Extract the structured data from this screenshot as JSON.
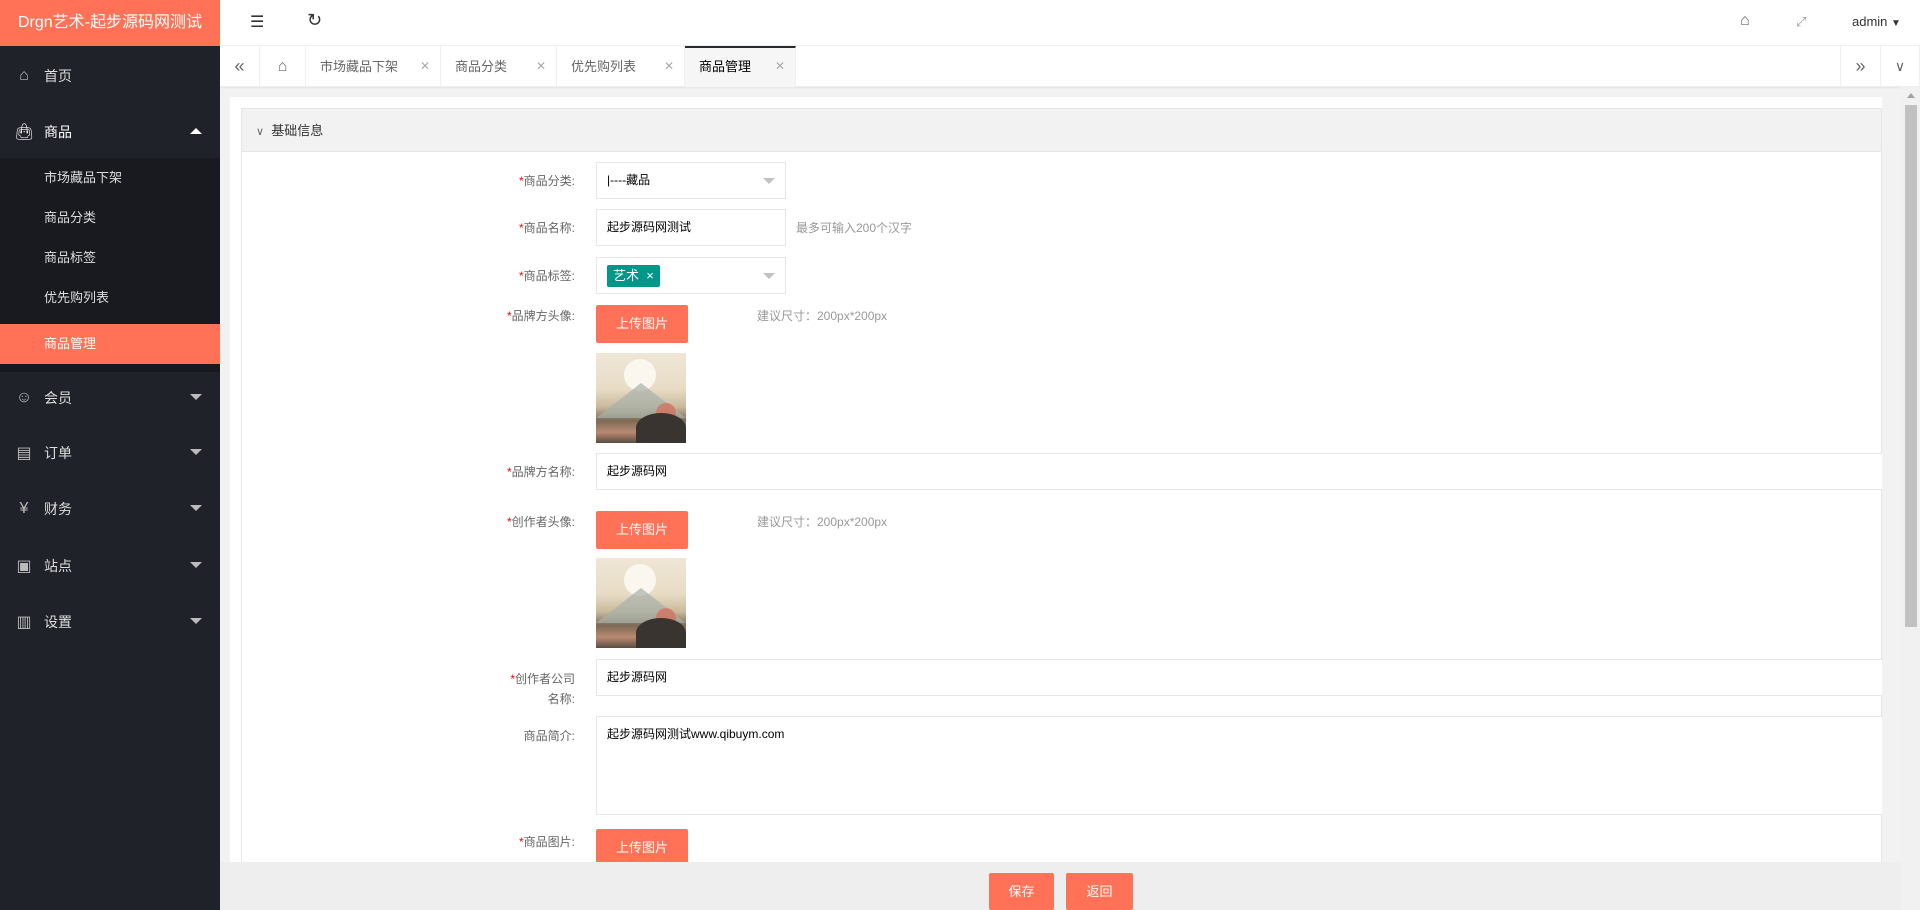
{
  "app": {
    "title": "Drgn艺术-起步源码网测试"
  },
  "header": {
    "user": "admin",
    "icons": [
      "menu-fold-icon",
      "refresh-icon",
      "tag-icon",
      "fullscreen-icon"
    ]
  },
  "sidebar": {
    "items": [
      {
        "label": "首页",
        "icon": "home-icon"
      },
      {
        "label": "商品",
        "icon": "shopping-bag-icon",
        "expanded": true,
        "children": [
          {
            "label": "市场藏品下架"
          },
          {
            "label": "商品分类"
          },
          {
            "label": "商品标签"
          },
          {
            "label": "优先购列表"
          },
          {
            "label": "商品管理",
            "active": true
          }
        ]
      },
      {
        "label": "会员",
        "icon": "user-icon"
      },
      {
        "label": "订单",
        "icon": "clipboard-icon"
      },
      {
        "label": "财务",
        "icon": "finance-icon"
      },
      {
        "label": "站点",
        "icon": "monitor-chart-icon"
      },
      {
        "label": "设置",
        "icon": "settings-monitor-icon"
      }
    ]
  },
  "tabs": [
    {
      "label": "市场藏品下架"
    },
    {
      "label": "商品分类"
    },
    {
      "label": "优先购列表"
    },
    {
      "label": "商品管理",
      "active": true
    }
  ],
  "form": {
    "section_title": "基础信息",
    "required_mark": "*",
    "category": {
      "label": "商品分类:",
      "value": "|----藏品"
    },
    "name": {
      "label": "商品名称:",
      "value": "起步源码网测试",
      "hint": "最多可输入200个汉字"
    },
    "tags": {
      "label": "商品标签:",
      "values": [
        "艺术"
      ],
      "remove": "×"
    },
    "brand_avatar": {
      "label": "品牌方头像:",
      "button": "上传图片",
      "hint": "建议尺寸：200px*200px"
    },
    "brand_name": {
      "label": "品牌方名称:",
      "value": "起步源码网"
    },
    "creator_avatar": {
      "label": "创作者头像:",
      "button": "上传图片",
      "hint": "建议尺寸：200px*200px"
    },
    "creator_company": {
      "label": "创作者公司名称:",
      "value": "起步源码网"
    },
    "intro": {
      "label": "商品简介:",
      "value": "起步源码网测试www.qibuym.com"
    },
    "images": {
      "label": "商品图片:",
      "button": "上传图片"
    }
  },
  "footer": {
    "save": "保存",
    "back": "返回"
  },
  "colors": {
    "accent": "#ff7257",
    "sidebar": "#20222a",
    "tag": "#009688"
  }
}
